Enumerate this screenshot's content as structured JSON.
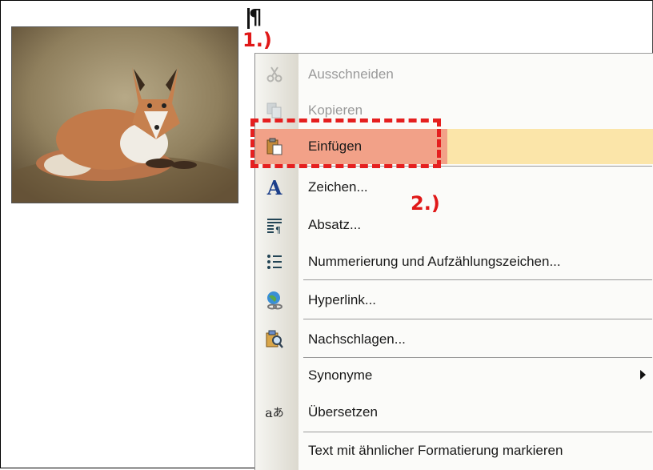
{
  "annotations": {
    "step1": "1.)",
    "step2": "2.)"
  },
  "cursor": {
    "glyph": "¶"
  },
  "context_menu": {
    "items": [
      {
        "label": "Ausschneiden",
        "icon": "scissors-icon",
        "state": "disabled"
      },
      {
        "label": "Kopieren",
        "icon": "copy-icon",
        "state": "disabled"
      },
      {
        "label": "Einfügen",
        "icon": "paste-icon",
        "state": "highlighted"
      },
      {
        "label": "Zeichen...",
        "icon": "font-icon",
        "state": "enabled"
      },
      {
        "label": "Absatz...",
        "icon": "paragraph-icon",
        "state": "enabled"
      },
      {
        "label": "Nummerierung und Aufzählungszeichen...",
        "icon": "bullet-list-icon",
        "state": "enabled"
      },
      {
        "label": "Hyperlink...",
        "icon": "hyperlink-icon",
        "state": "enabled"
      },
      {
        "label": "Nachschlagen...",
        "icon": "research-icon",
        "state": "enabled"
      },
      {
        "label": "Synonyme",
        "icon": "",
        "state": "enabled",
        "submenu": true
      },
      {
        "label": "Übersetzen",
        "icon": "translate-icon",
        "state": "enabled"
      },
      {
        "label": "Text mit ähnlicher Formatierung markieren",
        "icon": "",
        "state": "enabled"
      }
    ]
  },
  "colors": {
    "highlight": "#fbe5a9",
    "highlight_left": "#f2a188",
    "annotation_red": "#e01818",
    "disabled_text": "#9a9a9a"
  }
}
